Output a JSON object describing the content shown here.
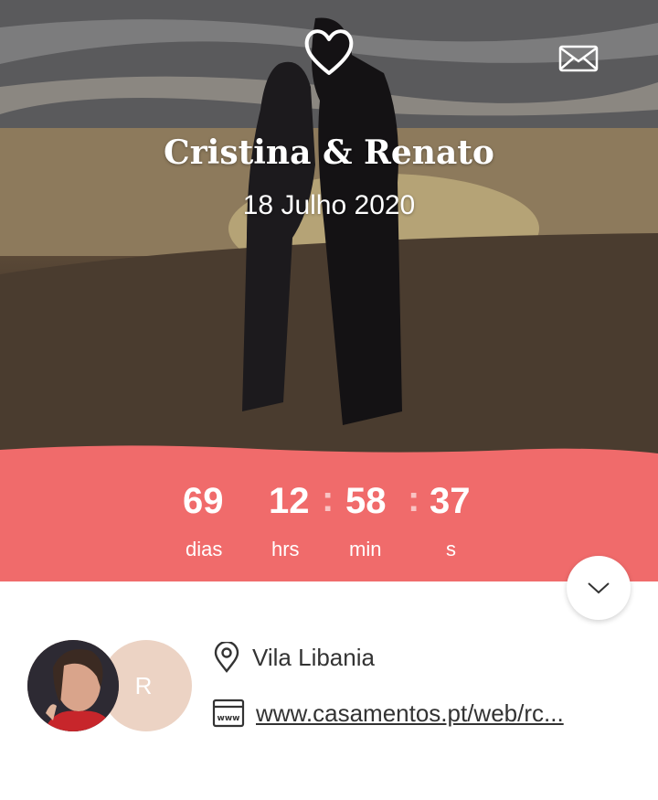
{
  "hero": {
    "couple_names": "Cristina & Renato",
    "wedding_date": "18 Julho 2020",
    "top_icon": "heart-icon",
    "action_icon": "envelope-icon"
  },
  "countdown": {
    "days": "69",
    "hours": "12",
    "minutes": "58",
    "seconds": "37",
    "separator": ":",
    "labels": {
      "days": "dias",
      "hours": "hrs",
      "minutes": "min",
      "seconds": "s"
    },
    "background_color": "#f06b6b"
  },
  "expand_button": {
    "icon": "chevron-down-icon"
  },
  "info": {
    "avatar_initial": "R",
    "location_icon": "map-pin-icon",
    "location": "Vila Libania",
    "website_icon": "www-icon",
    "website": "www.casamentos.pt/web/rc..."
  }
}
